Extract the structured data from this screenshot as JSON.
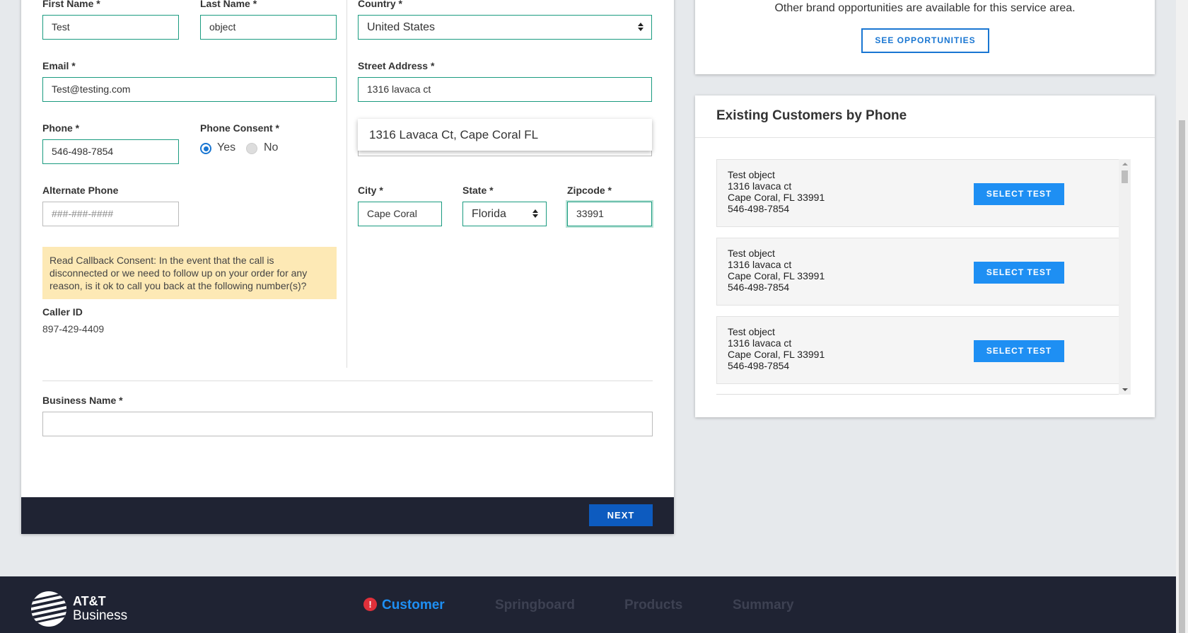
{
  "form": {
    "first_name_label": "First Name *",
    "first_name_value": "Test",
    "last_name_label": "Last Name *",
    "last_name_value": "object",
    "country_label": "Country *",
    "country_value": "United States",
    "email_label": "Email *",
    "email_value": "Test@testing.com",
    "street_label": "Street Address *",
    "street_value": "1316 lavaca ct",
    "autocomplete_suggestion": "1316 Lavaca Ct, Cape Coral FL",
    "phone_label": "Phone *",
    "phone_value": "546-498-7854",
    "consent_label": "Phone Consent *",
    "consent_yes": "Yes",
    "consent_no": "No",
    "alt_phone_label": "Alternate Phone",
    "alt_phone_placeholder": "###-###-####",
    "city_label": "City *",
    "city_value": "Cape Coral",
    "state_label": "State *",
    "state_value": "Florida",
    "zip_label": "Zipcode *",
    "zip_value": "33991",
    "callback_consent": "Read Callback Consent: In the event that the call is disconnected or we need to follow up on your order for any reason, is it ok to call you back at the following number(s)?",
    "caller_id_label": "Caller ID",
    "caller_id_value": "897-429-4409",
    "business_name_label": "Business Name *",
    "business_name_value": "",
    "next_label": "NEXT"
  },
  "opportunities": {
    "text": "Other brand opportunities are available for this service area.",
    "button": "SEE OPPORTUNITIES"
  },
  "existing_customers": {
    "title": "Existing Customers by Phone",
    "items": [
      {
        "name": "Test object",
        "street": "1316 lavaca ct",
        "city": "Cape Coral, FL 33991",
        "phone": "546-498-7854",
        "button": "SELECT TEST"
      },
      {
        "name": "Test object",
        "street": "1316 lavaca ct",
        "city": "Cape Coral, FL 33991",
        "phone": "546-498-7854",
        "button": "SELECT TEST"
      },
      {
        "name": "Test object",
        "street": "1316 lavaca ct",
        "city": "Cape Coral, FL 33991",
        "phone": "546-498-7854",
        "button": "SELECT TEST"
      }
    ]
  },
  "footer": {
    "logo_line1": "AT&T",
    "logo_line2": "Business",
    "steps": [
      "Customer",
      "Springboard",
      "Products",
      "Summary"
    ],
    "alert_glyph": "!"
  },
  "colors": {
    "accent_green": "#1a9b80",
    "primary_blue": "#1e8ff3",
    "dark_navy": "#1f2333",
    "warning_bg": "#fde9b5",
    "alert_red": "#e0303a"
  }
}
